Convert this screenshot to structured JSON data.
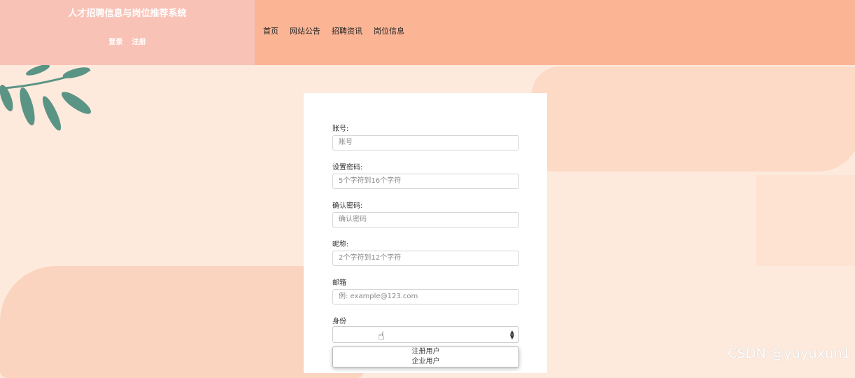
{
  "header": {
    "site_title": "人才招聘信息与岗位推荐系统",
    "login": "登录",
    "register": "注册",
    "nav": [
      "首页",
      "网站公告",
      "招聘资讯",
      "岗位信息"
    ]
  },
  "form": {
    "account_label": "账号:",
    "account_placeholder": "账号",
    "password_label": "设置密码:",
    "password_placeholder": "5个字符到16个字符",
    "confirm_label": "确认密码:",
    "confirm_placeholder": "确认密码",
    "nickname_label": "昵称:",
    "nickname_placeholder": "2个字符到12个字符",
    "email_label": "邮箱",
    "email_placeholder": "例: example@123.com",
    "identity_label": "身份",
    "identity_value": "",
    "identity_options": [
      "注册用户",
      "企业用户"
    ]
  },
  "watermark": "CSDN @yuyuxun1",
  "colors": {
    "brand": "#f9c2b6",
    "nav": "#fbb595",
    "background": "#fdeadd"
  }
}
